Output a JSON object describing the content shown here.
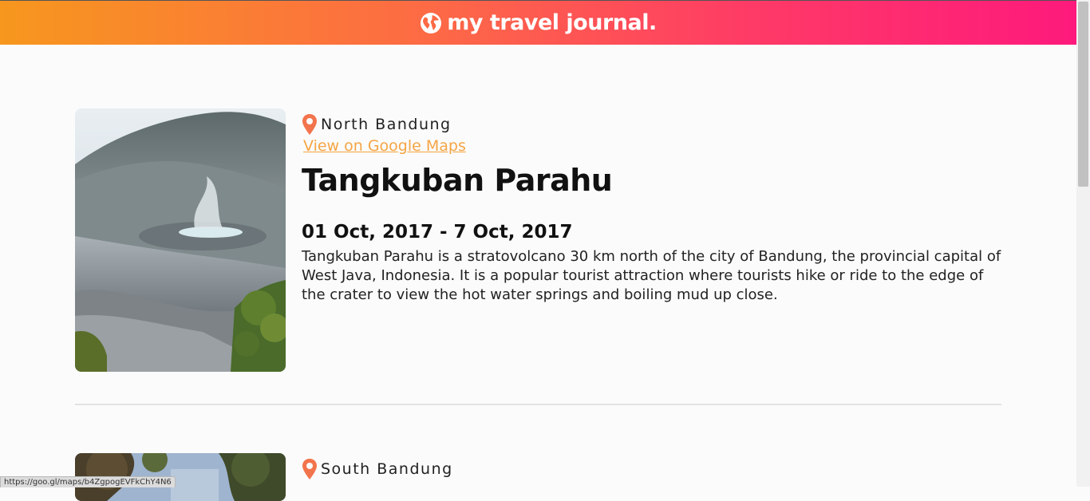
{
  "header": {
    "title": "my travel journal."
  },
  "entries": [
    {
      "location": "North Bandung",
      "maps_link": "View on Google Maps",
      "title": "Tangkuban Parahu",
      "dates": "01 Oct, 2017 - 7 Oct, 2017",
      "description": "Tangkuban Parahu is a stratovolcano 30 km north of the city of Bandung, the provincial capital of West Java, Indonesia. It is a popular tourist attraction where tourists hike or ride to the edge of the crater to view the hot water springs and boiling mud up close."
    },
    {
      "location": "South Bandung"
    }
  ],
  "status_bar": {
    "url": "https://goo.gl/maps/b4ZgpogEVFkChY4N6"
  },
  "colors": {
    "header_gradient_start": "#f7971e",
    "header_gradient_end": "#fe1a7c",
    "link": "#f5a545",
    "pin": "#f2744d"
  },
  "icons": {
    "brand": "globe-icon",
    "location": "map-pin-icon"
  }
}
